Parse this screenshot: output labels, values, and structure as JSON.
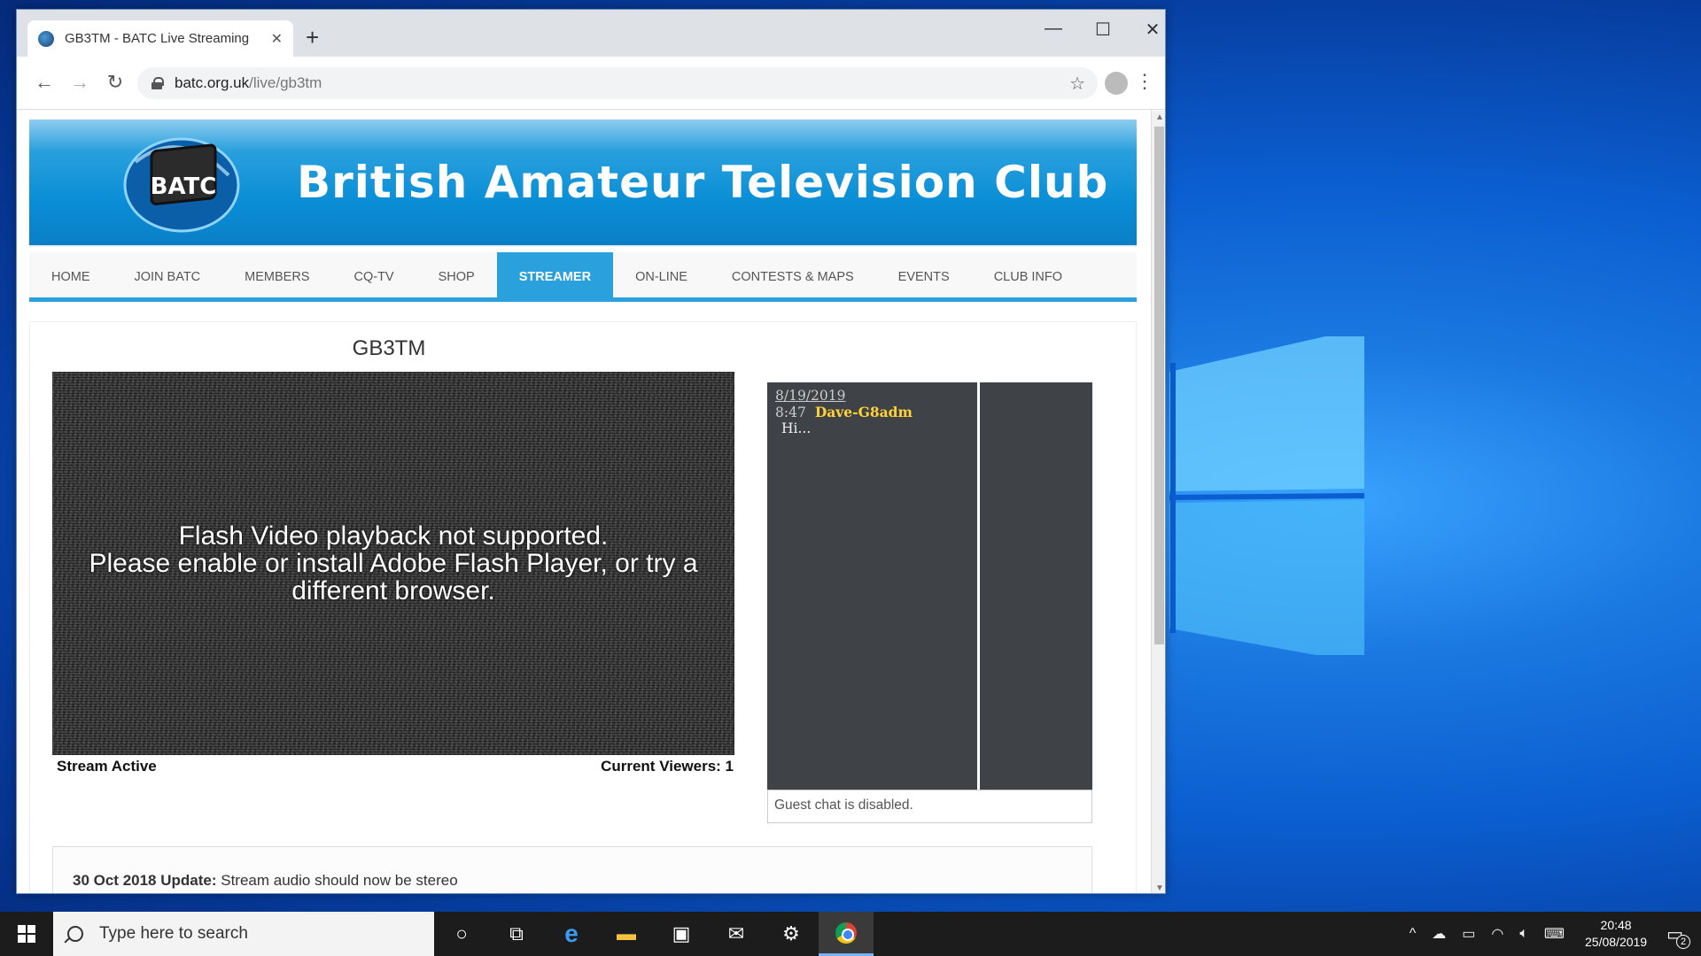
{
  "browser": {
    "tab_title": "GB3TM - BATC Live Streaming",
    "tab_close": "✕",
    "new_tab": "+",
    "minimize": "—",
    "maximize": "☐",
    "close": "✕",
    "url_host": "batc.org.uk",
    "url_path": "/live/gb3tm",
    "icons": [
      "back-arrow-icon",
      "forward-arrow-icon",
      "reload-icon",
      "lock-icon",
      "star-icon",
      "profile-icon",
      "menu-dots-icon"
    ]
  },
  "site": {
    "logo_text": "BATC",
    "banner_title": "British Amateur Television Club",
    "nav": [
      {
        "label": "HOME",
        "active": false
      },
      {
        "label": "JOIN BATC",
        "active": false
      },
      {
        "label": "MEMBERS",
        "active": false
      },
      {
        "label": "CQ-TV",
        "active": false
      },
      {
        "label": "SHOP",
        "active": false
      },
      {
        "label": "STREAMER",
        "active": true
      },
      {
        "label": "ON-LINE",
        "active": false
      },
      {
        "label": "CONTESTS & MAPS",
        "active": false
      },
      {
        "label": "EVENTS",
        "active": false
      },
      {
        "label": "CLUB INFO",
        "active": false
      }
    ],
    "accent_color": "#2aa0dd"
  },
  "stream": {
    "title": "GB3TM",
    "flash_line1": "Flash Video playback not supported.",
    "flash_line2": "Please enable or install Adobe Flash Player, or try a different browser.",
    "status": "Stream Active",
    "viewers": "Current Viewers: 1"
  },
  "chat": {
    "date": "8/19/2019",
    "messages": [
      {
        "time": "8:47",
        "user": "Dave-G8adm",
        "text": "Hi..."
      }
    ],
    "disabled_text": "Guest chat is disabled."
  },
  "update": {
    "date_label": "30 Oct 2018 Update:",
    "text": " Stream audio should now be stereo"
  },
  "taskbar": {
    "search_placeholder": "Type here to search",
    "time": "20:48",
    "date": "25/08/2019",
    "notification_count": "2",
    "icons": [
      "cortana-icon",
      "task-view-icon",
      "edge-icon",
      "file-explorer-icon",
      "store-icon",
      "mail-icon",
      "settings-icon",
      "chrome-icon"
    ]
  }
}
